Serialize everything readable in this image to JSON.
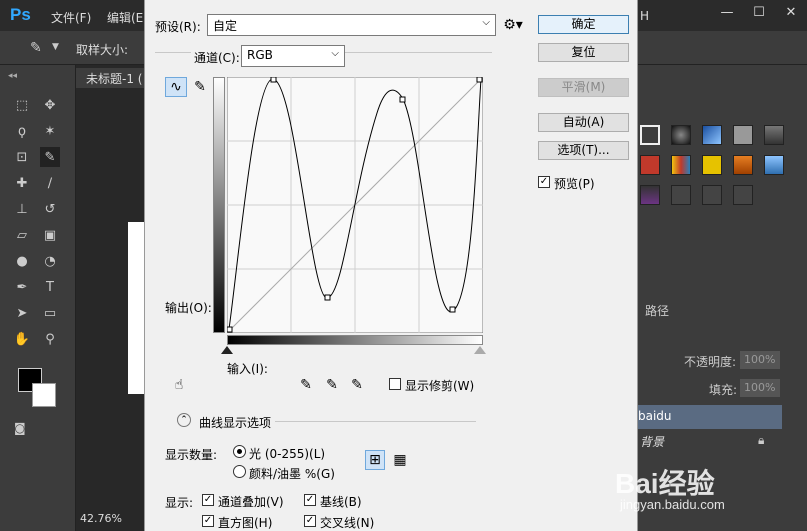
{
  "ps": {
    "logo": "Ps",
    "menu": [
      "文件(F)",
      "编辑(E"
    ],
    "options_label": "取样大小:",
    "doc_tab": "未标题-1 (",
    "zoom": "42.76%",
    "paths_tab": "路径",
    "opacity_label": "不透明度:",
    "opacity_value": "100%",
    "fill_label": "填充:",
    "fill_value": "100%",
    "layer_name": "baidu",
    "background_layer": "背景",
    "window_title_tail": "H"
  },
  "dialog": {
    "preset_label": "预设(R):",
    "preset_value": "自定",
    "channel_label": "通道(C):",
    "channel_value": "RGB",
    "output_label": "输出(O):",
    "input_label": "输入(I):",
    "show_clipping": "显示修剪(W)",
    "buttons": {
      "ok": "确定",
      "reset": "复位",
      "smooth": "平滑(M)",
      "auto": "自动(A)",
      "options": "选项(T)..."
    },
    "preview_label": "预览(P)",
    "preview_checked": true,
    "curve_options_title": "曲线显示选项",
    "show_amount_label": "显示数量:",
    "light_option": "光 (0-255)(L)",
    "pigment_option": "颜料/油墨 %(G)",
    "show_label": "显示:",
    "channel_overlay": "通道叠加(V)",
    "baseline": "基线(B)",
    "histogram": "直方图(H)",
    "intersection": "交叉线(N)"
  },
  "watermark": {
    "brand": "Bai经验",
    "url": "jingyan.baidu.com"
  }
}
